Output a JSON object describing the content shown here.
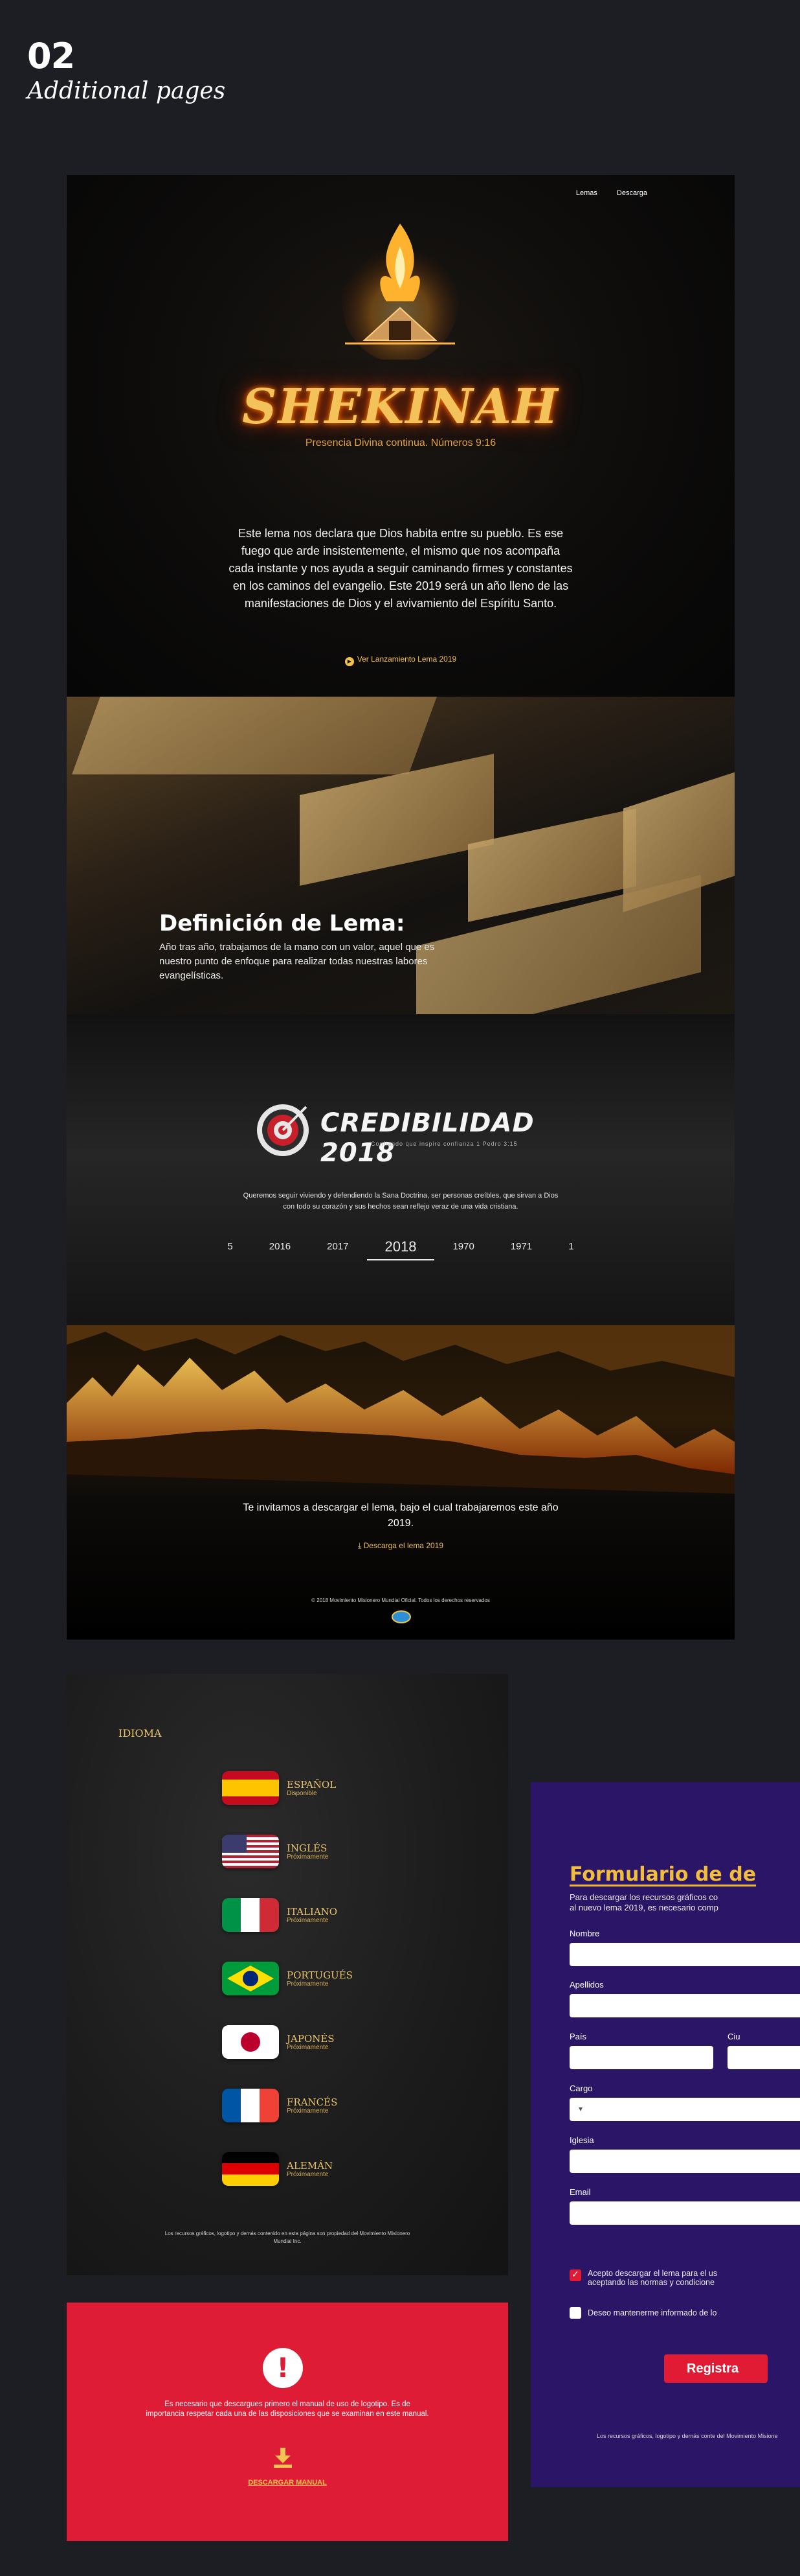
{
  "header": {
    "number": "02",
    "subtitle": "Additional pages"
  },
  "landing": {
    "nav": [
      "Lemas",
      "Descarga"
    ],
    "logo_word": "SHEKINAH",
    "logo_tagline": "Presencia Divina continua. Números 9:16",
    "intro": "Este lema nos declara que Dios habita entre su pueblo. Es ese fuego que arde insistentemente, el mismo que nos acompaña cada instante y nos ayuda a seguir caminando firmes y constantes en los caminos del evangelio. Este 2019 será un año lleno de las manifestaciones de Dios y el avivamiento del Espíritu Santo.",
    "video_link": "Ver Lanzamiento Lema 2019",
    "definition_title": "Definición de Lema:",
    "definition_text": "Año tras año, trabajamos de la mano con un valor, aquel que es nuestro punto de enfoque para realizar todas nuestras labores evangelísticas.",
    "credibility_word": "CREDIBILIDAD 2018",
    "credibility_sub": "Confiando que inspire confianza 1 Pedro 3:15",
    "credibility_text": "Queremos seguir viviendo y defendiendo la Sana Doctrina, ser personas creíbles, que sirvan a Dios con todo su corazón y sus hechos sean reflejo veraz de una vida cristiana.",
    "years": [
      "5",
      "2016",
      "2017",
      "2018",
      "1970",
      "1971",
      "1"
    ],
    "active_year": "2018",
    "download_text": "Te invitamos a descargar el lema, bajo el cual trabajaremos este año 2019.",
    "download_link": "Descarga el lema 2019",
    "footer": "© 2018 Movimiento Misionero Mundial Oficial. Todos los derechos reservados"
  },
  "language": {
    "title": "IDIOMA",
    "items": [
      {
        "name": "ESPAÑOL",
        "status": "Disponible"
      },
      {
        "name": "INGLÉS",
        "status": "Próximamente"
      },
      {
        "name": "ITALIANO",
        "status": "Próximamente"
      },
      {
        "name": "PORTUGUÉS",
        "status": "Próximamente"
      },
      {
        "name": "JAPONÉS",
        "status": "Próximamente"
      },
      {
        "name": "FRANCÉS",
        "status": "Próximamente"
      },
      {
        "name": "ALEMÁN",
        "status": "Próximamente"
      }
    ],
    "footer": "Los recursos gráficos, logotipo y demás contenido en esta página son propiedad del Movimiento Misionero Mundial Inc."
  },
  "alert": {
    "icon": "!",
    "text": "Es necesario que descargues primero el manual de uso de logotipo. Es de importancia respetar cada una de las disposiciones que se examinan en este manual.",
    "link": "DESCARGAR MANUAL"
  },
  "form": {
    "title": "Formulario de de",
    "intro_1": "Para descargar los recursos gráficos co",
    "intro_2": "al nuevo lema 2019, es necesario comp",
    "labels": {
      "nombre": "Nombre",
      "apellidos": "Apellidos",
      "pais": "País",
      "ciudad": "Ciu",
      "cargo": "Cargo",
      "iglesia": "Iglesia",
      "email": "Email"
    },
    "accept_1": "Acepto descargar el lema para el us",
    "accept_2": "aceptando las normas y condicione",
    "updates": "Deseo mantenerme informado de lo",
    "button": "Registra",
    "footer": "Los recursos gráficos, logotipo y demás conte del Movimiento Misione"
  },
  "colors": {
    "gold": "#f2c14a",
    "alert_red": "#df1c35",
    "form_purple": "#2a1567",
    "button_red": "#e01b33"
  }
}
